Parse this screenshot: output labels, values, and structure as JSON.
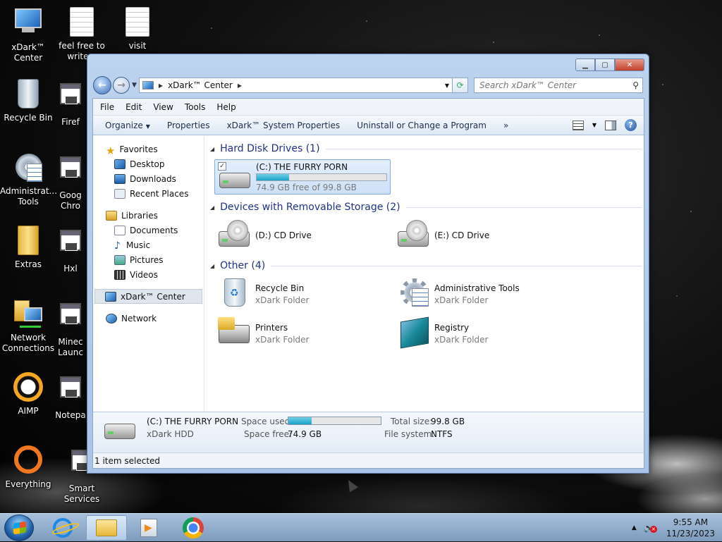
{
  "desktop": {
    "icons": [
      {
        "label": "xDark™\nCenter",
        "icon": "computer-icon"
      },
      {
        "label": "feel free to\nwrite a",
        "icon": "document-icon"
      },
      {
        "label": "visit",
        "icon": "document-icon"
      },
      {
        "label": "Recycle Bin",
        "icon": "recycle-bin-icon"
      },
      {
        "label": "Firef",
        "icon": "application-icon"
      },
      {
        "label": "Administrat...\nTools",
        "icon": "admin-tools-icon"
      },
      {
        "label": "Goog\nChro",
        "icon": "application-icon"
      },
      {
        "label": "Extras",
        "icon": "folder-icon"
      },
      {
        "label": "Hxl",
        "icon": "application-icon"
      },
      {
        "label": "Network\nConnections",
        "icon": "network-icon"
      },
      {
        "label": "Minec\nLaunc",
        "icon": "application-icon"
      },
      {
        "label": "AIMP",
        "icon": "aimp-icon"
      },
      {
        "label": "Notepa",
        "icon": "application-icon"
      },
      {
        "label": "Everything",
        "icon": "everything-icon"
      },
      {
        "label": "Smart\nServices",
        "icon": "application-icon"
      }
    ]
  },
  "window": {
    "address": {
      "root_icon": "computer-icon",
      "path": "xDark™ Center"
    },
    "search_placeholder": "Search xDark™ Center",
    "menu": [
      "File",
      "Edit",
      "View",
      "Tools",
      "Help"
    ],
    "toolbar": {
      "organize": "Organize",
      "properties": "Properties",
      "system_properties": "xDark™ System Properties",
      "uninstall": "Uninstall or Change a Program",
      "more": "»"
    },
    "nav": {
      "favorites": "Favorites",
      "desktop": "Desktop",
      "downloads": "Downloads",
      "recent": "Recent Places",
      "libraries": "Libraries",
      "documents": "Documents",
      "music": "Music",
      "pictures": "Pictures",
      "videos": "Videos",
      "computer": "xDark™ Center",
      "network": "Network"
    },
    "groups": {
      "hdd": "Hard Disk Drives (1)",
      "removable": "Devices with Removable Storage (2)",
      "other": "Other (4)"
    },
    "items": {
      "c_drive": {
        "name": "(C:) THE FURRY PORN",
        "free": "74.9 GB free of 99.8 GB",
        "used_fraction": 0.25
      },
      "d_drive": {
        "name": "(D:) CD Drive"
      },
      "e_drive": {
        "name": "(E:) CD Drive"
      },
      "recycle": {
        "name": "Recycle Bin",
        "type": "xDark Folder"
      },
      "admin": {
        "name": "Administrative Tools",
        "type": "xDark Folder"
      },
      "printers": {
        "name": "Printers",
        "type": "xDark Folder"
      },
      "registry": {
        "name": "Registry",
        "type": "xDark Folder"
      }
    },
    "details": {
      "name": "(C:) THE FURRY PORN",
      "type": "xDark HDD",
      "space_used_label": "Space used:",
      "space_free_label": "Space free:",
      "space_free": "74.9 GB",
      "total_label": "Total size:",
      "total": "99.8 GB",
      "fs_label": "File system:",
      "fs": "NTFS",
      "used_fraction": 0.25
    },
    "status": "1 item selected"
  },
  "taskbar": {
    "time": "9:55 AM",
    "date": "11/23/2023",
    "apps": [
      "internet-explorer-icon",
      "file-explorer-icon",
      "media-player-icon",
      "chrome-icon"
    ]
  }
}
